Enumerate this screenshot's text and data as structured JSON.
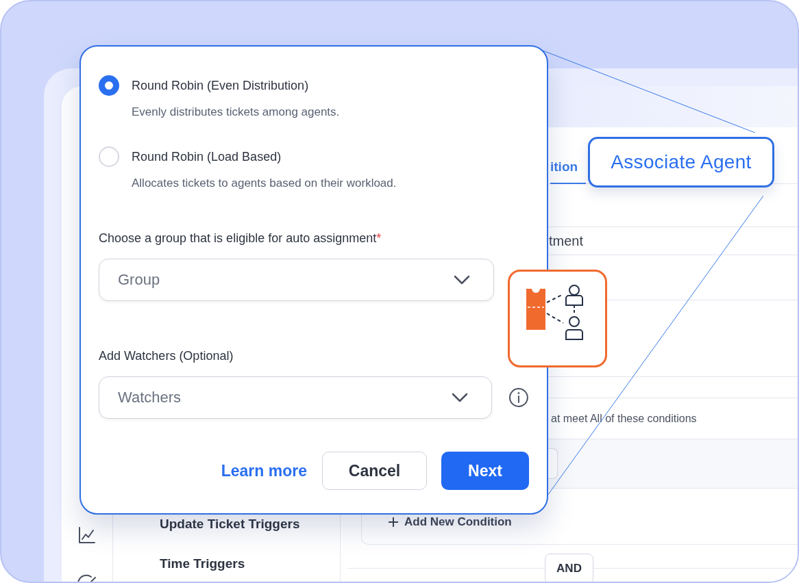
{
  "dialog": {
    "options": [
      {
        "title": "Round Robin (Even Distribution)",
        "description": "Evenly distributes tickets among agents.",
        "selected": true
      },
      {
        "title": "Round Robin (Load Based)",
        "description": "Allocates tickets to agents based on their workload.",
        "selected": false
      }
    ],
    "group_field": {
      "label": "Choose a group that is eligible for auto assignment",
      "required_mark": "*",
      "placeholder": "Group"
    },
    "watchers_field": {
      "label": "Add Watchers (Optional)",
      "placeholder": "Watchers"
    },
    "buttons": {
      "learn_more": "Learn more",
      "cancel": "Cancel",
      "next": "Next"
    }
  },
  "callout": {
    "label": "Associate Agent"
  },
  "background": {
    "tab": "ition",
    "field_value": "tment",
    "conditions_text": "at meet All of these conditions",
    "add_condition": "Add New Condition",
    "menu_items": [
      "Update Ticket Triggers",
      "Time Triggers"
    ],
    "operator": "AND"
  }
}
